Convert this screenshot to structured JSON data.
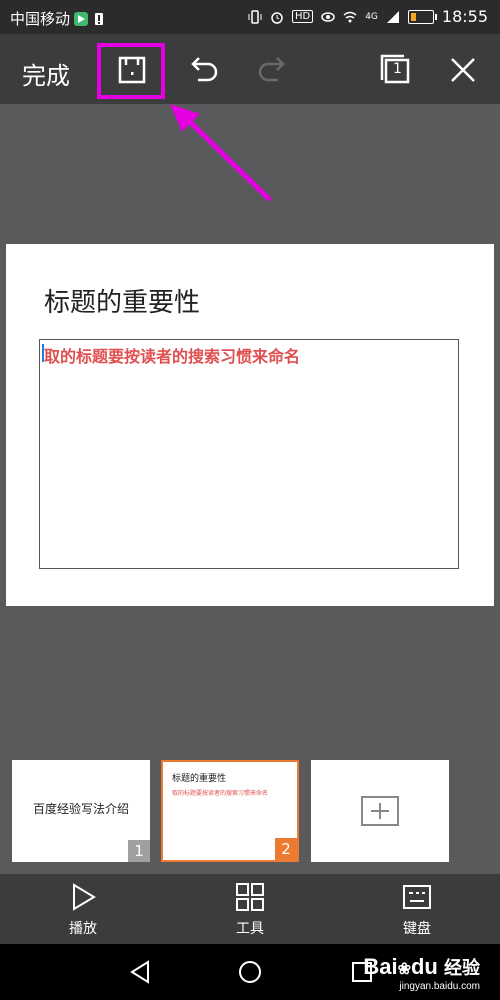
{
  "status_bar": {
    "carrier": "中国移动",
    "time": "18:55",
    "network": "4G",
    "hd_badge": "HD"
  },
  "toolbar": {
    "done_label": "完成",
    "page_count_badge": "1"
  },
  "slide": {
    "title": "标题的重要性",
    "body": "取的标题要按读者的搜索习惯来命名"
  },
  "thumbnails": {
    "items": [
      {
        "title": "百度经验写法介绍",
        "number": "1"
      },
      {
        "title": "标题的重要性",
        "subtitle": "取的标题要按读者的搜索习惯来命名",
        "number": "2"
      }
    ]
  },
  "bottom_bar": {
    "play_label": "播放",
    "tools_label": "工具",
    "keyboard_label": "键盘"
  },
  "watermark": {
    "brand": "Bai",
    "brand2": "du",
    "suffix": "经验",
    "url": "jingyan.baidu.com"
  },
  "colors": {
    "highlight": "#e400e0",
    "slide_body_text": "#e05050",
    "selected_thumb_border": "#ec7a30"
  },
  "icons": [
    "save-icon",
    "undo-icon",
    "redo-icon",
    "pages-icon",
    "close-icon",
    "play-icon",
    "tools-icon",
    "keyboard-icon",
    "plus-icon",
    "back-icon",
    "home-icon",
    "recent-icon"
  ]
}
